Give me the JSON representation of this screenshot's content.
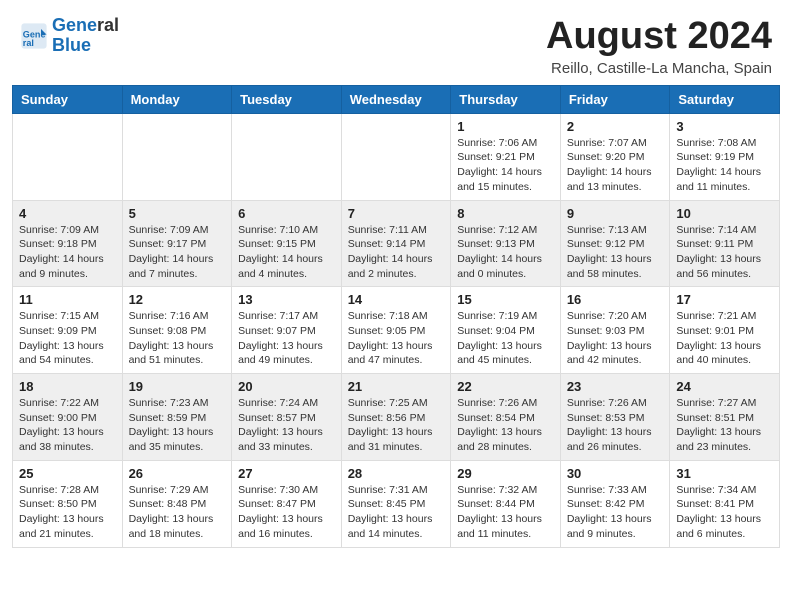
{
  "header": {
    "logo_line1": "General",
    "logo_line2": "Blue",
    "month_title": "August 2024",
    "subtitle": "Reillo, Castille-La Mancha, Spain"
  },
  "days_of_week": [
    "Sunday",
    "Monday",
    "Tuesday",
    "Wednesday",
    "Thursday",
    "Friday",
    "Saturday"
  ],
  "weeks": [
    [
      {
        "day": "",
        "info": ""
      },
      {
        "day": "",
        "info": ""
      },
      {
        "day": "",
        "info": ""
      },
      {
        "day": "",
        "info": ""
      },
      {
        "day": "1",
        "info": "Sunrise: 7:06 AM\nSunset: 9:21 PM\nDaylight: 14 hours\nand 15 minutes."
      },
      {
        "day": "2",
        "info": "Sunrise: 7:07 AM\nSunset: 9:20 PM\nDaylight: 14 hours\nand 13 minutes."
      },
      {
        "day": "3",
        "info": "Sunrise: 7:08 AM\nSunset: 9:19 PM\nDaylight: 14 hours\nand 11 minutes."
      }
    ],
    [
      {
        "day": "4",
        "info": "Sunrise: 7:09 AM\nSunset: 9:18 PM\nDaylight: 14 hours\nand 9 minutes."
      },
      {
        "day": "5",
        "info": "Sunrise: 7:09 AM\nSunset: 9:17 PM\nDaylight: 14 hours\nand 7 minutes."
      },
      {
        "day": "6",
        "info": "Sunrise: 7:10 AM\nSunset: 9:15 PM\nDaylight: 14 hours\nand 4 minutes."
      },
      {
        "day": "7",
        "info": "Sunrise: 7:11 AM\nSunset: 9:14 PM\nDaylight: 14 hours\nand 2 minutes."
      },
      {
        "day": "8",
        "info": "Sunrise: 7:12 AM\nSunset: 9:13 PM\nDaylight: 14 hours\nand 0 minutes."
      },
      {
        "day": "9",
        "info": "Sunrise: 7:13 AM\nSunset: 9:12 PM\nDaylight: 13 hours\nand 58 minutes."
      },
      {
        "day": "10",
        "info": "Sunrise: 7:14 AM\nSunset: 9:11 PM\nDaylight: 13 hours\nand 56 minutes."
      }
    ],
    [
      {
        "day": "11",
        "info": "Sunrise: 7:15 AM\nSunset: 9:09 PM\nDaylight: 13 hours\nand 54 minutes."
      },
      {
        "day": "12",
        "info": "Sunrise: 7:16 AM\nSunset: 9:08 PM\nDaylight: 13 hours\nand 51 minutes."
      },
      {
        "day": "13",
        "info": "Sunrise: 7:17 AM\nSunset: 9:07 PM\nDaylight: 13 hours\nand 49 minutes."
      },
      {
        "day": "14",
        "info": "Sunrise: 7:18 AM\nSunset: 9:05 PM\nDaylight: 13 hours\nand 47 minutes."
      },
      {
        "day": "15",
        "info": "Sunrise: 7:19 AM\nSunset: 9:04 PM\nDaylight: 13 hours\nand 45 minutes."
      },
      {
        "day": "16",
        "info": "Sunrise: 7:20 AM\nSunset: 9:03 PM\nDaylight: 13 hours\nand 42 minutes."
      },
      {
        "day": "17",
        "info": "Sunrise: 7:21 AM\nSunset: 9:01 PM\nDaylight: 13 hours\nand 40 minutes."
      }
    ],
    [
      {
        "day": "18",
        "info": "Sunrise: 7:22 AM\nSunset: 9:00 PM\nDaylight: 13 hours\nand 38 minutes."
      },
      {
        "day": "19",
        "info": "Sunrise: 7:23 AM\nSunset: 8:59 PM\nDaylight: 13 hours\nand 35 minutes."
      },
      {
        "day": "20",
        "info": "Sunrise: 7:24 AM\nSunset: 8:57 PM\nDaylight: 13 hours\nand 33 minutes."
      },
      {
        "day": "21",
        "info": "Sunrise: 7:25 AM\nSunset: 8:56 PM\nDaylight: 13 hours\nand 31 minutes."
      },
      {
        "day": "22",
        "info": "Sunrise: 7:26 AM\nSunset: 8:54 PM\nDaylight: 13 hours\nand 28 minutes."
      },
      {
        "day": "23",
        "info": "Sunrise: 7:26 AM\nSunset: 8:53 PM\nDaylight: 13 hours\nand 26 minutes."
      },
      {
        "day": "24",
        "info": "Sunrise: 7:27 AM\nSunset: 8:51 PM\nDaylight: 13 hours\nand 23 minutes."
      }
    ],
    [
      {
        "day": "25",
        "info": "Sunrise: 7:28 AM\nSunset: 8:50 PM\nDaylight: 13 hours\nand 21 minutes."
      },
      {
        "day": "26",
        "info": "Sunrise: 7:29 AM\nSunset: 8:48 PM\nDaylight: 13 hours\nand 18 minutes."
      },
      {
        "day": "27",
        "info": "Sunrise: 7:30 AM\nSunset: 8:47 PM\nDaylight: 13 hours\nand 16 minutes."
      },
      {
        "day": "28",
        "info": "Sunrise: 7:31 AM\nSunset: 8:45 PM\nDaylight: 13 hours\nand 14 minutes."
      },
      {
        "day": "29",
        "info": "Sunrise: 7:32 AM\nSunset: 8:44 PM\nDaylight: 13 hours\nand 11 minutes."
      },
      {
        "day": "30",
        "info": "Sunrise: 7:33 AM\nSunset: 8:42 PM\nDaylight: 13 hours\nand 9 minutes."
      },
      {
        "day": "31",
        "info": "Sunrise: 7:34 AM\nSunset: 8:41 PM\nDaylight: 13 hours\nand 6 minutes."
      }
    ]
  ]
}
